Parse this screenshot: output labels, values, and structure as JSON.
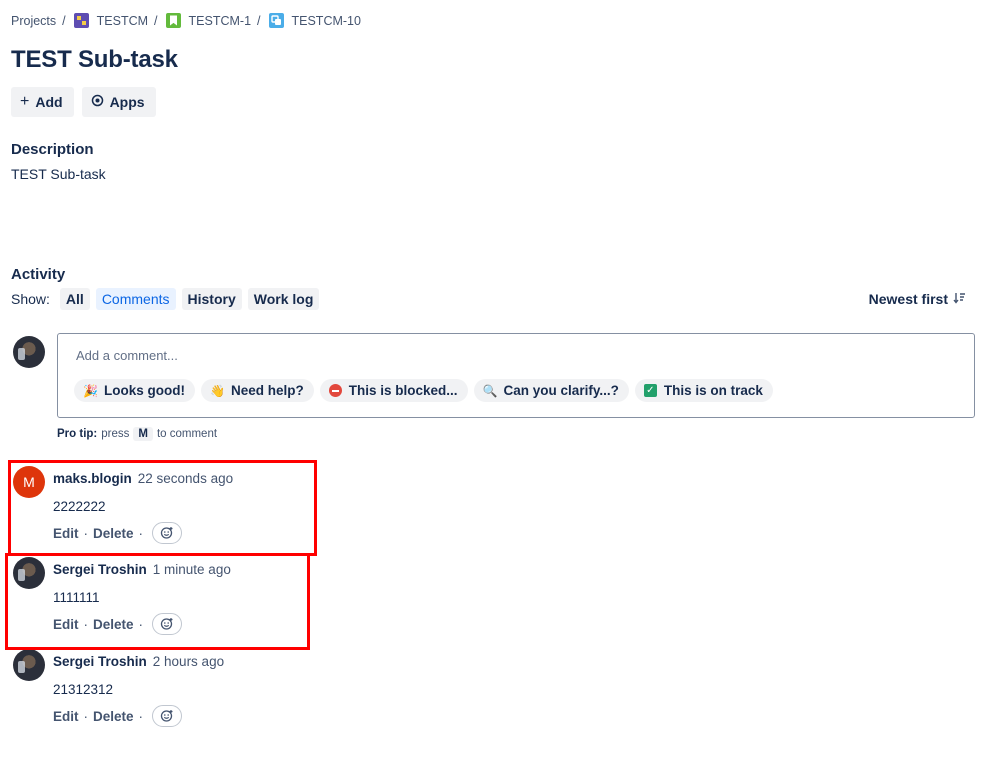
{
  "breadcrumb": {
    "projects": "Projects",
    "project": "TESTCM",
    "parent": "TESTCM-1",
    "issue": "TESTCM-10",
    "separator": "/"
  },
  "issue": {
    "title": "TEST Sub-task"
  },
  "toolbar": {
    "add_label": "Add",
    "apps_label": "Apps"
  },
  "description": {
    "heading": "Description",
    "text": "TEST Sub-task"
  },
  "activity": {
    "heading": "Activity",
    "show_label": "Show:",
    "filters": [
      "All",
      "Comments",
      "History",
      "Work log"
    ],
    "active_filter": "Comments",
    "sort_label": "Newest first"
  },
  "comment_editor": {
    "placeholder": "Add a comment...",
    "quick_replies": [
      {
        "emoji": "🎉",
        "label": "Looks good!"
      },
      {
        "emoji": "👋",
        "label": "Need help?"
      },
      {
        "emoji": "no-entry-icon",
        "label": "This is blocked..."
      },
      {
        "emoji": "🔍",
        "label": "Can you clarify...?"
      },
      {
        "emoji": "check-icon",
        "label": "This is on track"
      }
    ],
    "pro_tip_prefix": "Pro tip:",
    "pro_tip_press": "press",
    "pro_tip_key": "M",
    "pro_tip_suffix": "to comment"
  },
  "comments": [
    {
      "author": "maks.blogin",
      "avatar_letter": "M",
      "time": "22 seconds ago",
      "body": "2222222",
      "edit": "Edit",
      "delete": "Delete",
      "highlighted": true
    },
    {
      "author": "Sergei Troshin",
      "time": "1 minute ago",
      "body": "1111111",
      "edit": "Edit",
      "delete": "Delete",
      "highlighted": true
    },
    {
      "author": "Sergei Troshin",
      "time": "2 hours ago",
      "body": "21312312",
      "edit": "Edit",
      "delete": "Delete",
      "highlighted": false
    }
  ],
  "colors": {
    "highlight": "#ff0000",
    "link_blue": "#0c66e4",
    "avatar_red": "#de350b"
  }
}
